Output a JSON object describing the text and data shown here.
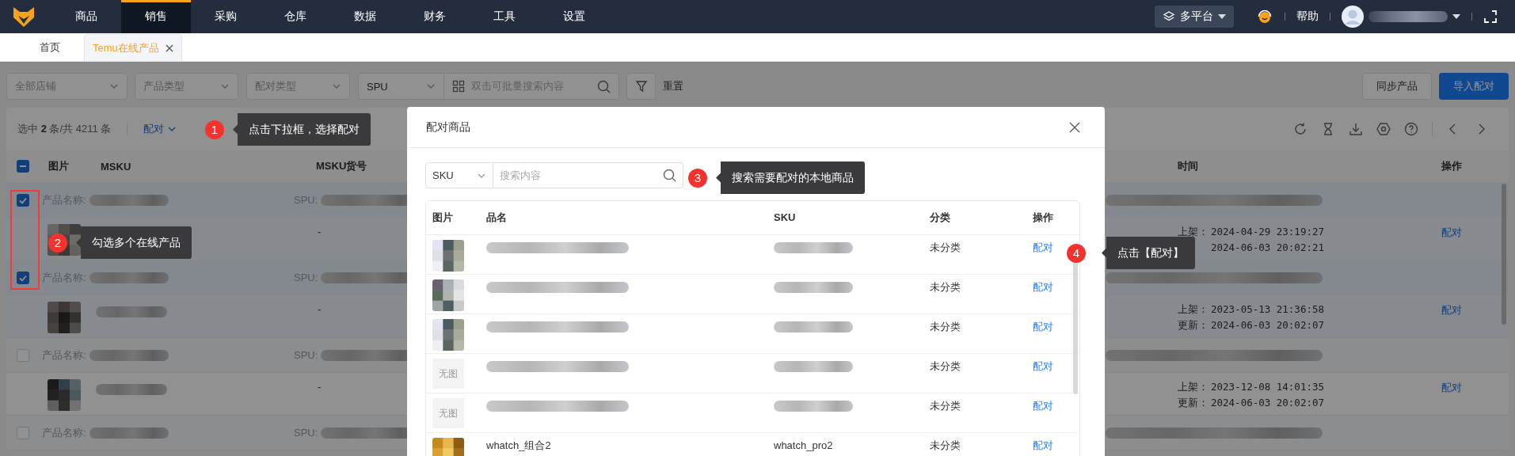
{
  "nav": {
    "menu": [
      {
        "label": "商品",
        "selected": false
      },
      {
        "label": "销售",
        "selected": true
      },
      {
        "label": "采购",
        "selected": false
      },
      {
        "label": "仓库",
        "selected": false
      },
      {
        "label": "数据",
        "selected": false
      },
      {
        "label": "财务",
        "selected": false
      },
      {
        "label": "工具",
        "selected": false
      },
      {
        "label": "设置",
        "selected": false
      }
    ],
    "platform": "多平台",
    "help": "帮助"
  },
  "tabs": [
    {
      "label": "首页",
      "selected": false,
      "closable": false
    },
    {
      "label": "Temu在线产品",
      "selected": true,
      "closable": true
    }
  ],
  "filters": {
    "shop": "全部店铺",
    "product_type": "产品类型",
    "pair_type": "配对类型",
    "search_field": "SPU",
    "search_placeholder": "双击可批量搜索内容",
    "reset": "重置"
  },
  "actions": [
    {
      "label": "同步产品",
      "kind": "default"
    },
    {
      "label": "导入配对",
      "kind": "primary"
    }
  ],
  "toolbar": {
    "selection": "选中 **2** 条/共 4211 条",
    "bulk_action": "配对"
  },
  "table": {
    "select_all_partial": true,
    "columns": [
      "图片",
      "MSKU",
      "MSKU货号",
      "时间",
      "操作"
    ],
    "groups": [
      {
        "checked": true,
        "name_label": "产品名称:",
        "spu_label": "SPU:",
        "msku_no": "-",
        "listed_label": "上架：",
        "listed": "2024-04-29 23:19:27",
        "updated": "2024-06-03 20:02:21",
        "action": "配对"
      },
      {
        "checked": true,
        "name_label": "产品名称:",
        "spu_label": "SPU:",
        "msku_no": "-",
        "listed_label": "上架：",
        "listed": "2023-05-13 21:36:58",
        "updated_label": "更新：",
        "updated": "2024-06-03 20:02:07",
        "action": "配对"
      },
      {
        "checked": false,
        "name_label": "产品名称:",
        "spu_label": "SPU:",
        "msku_no": "-",
        "listed_label": "上架：",
        "listed": "2023-12-08 14:01:35",
        "updated_label": "更新：",
        "updated": "2024-06-03 20:02:07",
        "action": "配对"
      },
      {
        "checked": false,
        "name_label": "产品名称:",
        "spu_label": "SPU:"
      }
    ]
  },
  "modal": {
    "title": "配对商品",
    "search_field": "SKU",
    "search_placeholder": "搜索内容",
    "columns": [
      "图片",
      "品名",
      "SKU",
      "分类",
      "操作"
    ],
    "rows": [
      {
        "category": "未分类",
        "action": "配对"
      },
      {
        "category": "未分类",
        "action": "配对"
      },
      {
        "category": "未分类",
        "action": "配对"
      },
      {
        "kind": "none",
        "no_image": "无图",
        "category": "未分类",
        "action": "配对"
      },
      {
        "kind": "none",
        "no_image": "无图",
        "category": "未分类",
        "action": "配对"
      },
      {
        "name": "whatch_组合2",
        "sku": "whatch_pro2",
        "category": "未分类",
        "action": "配对"
      }
    ]
  },
  "guides": [
    {
      "number": "1",
      "text": "点击下拉框，选择配对"
    },
    {
      "number": "2",
      "text": "勾选多个在线产品"
    },
    {
      "number": "3",
      "text": "搜索需要配对的本地商品"
    },
    {
      "number": "4",
      "text": "点击【配对】"
    }
  ]
}
